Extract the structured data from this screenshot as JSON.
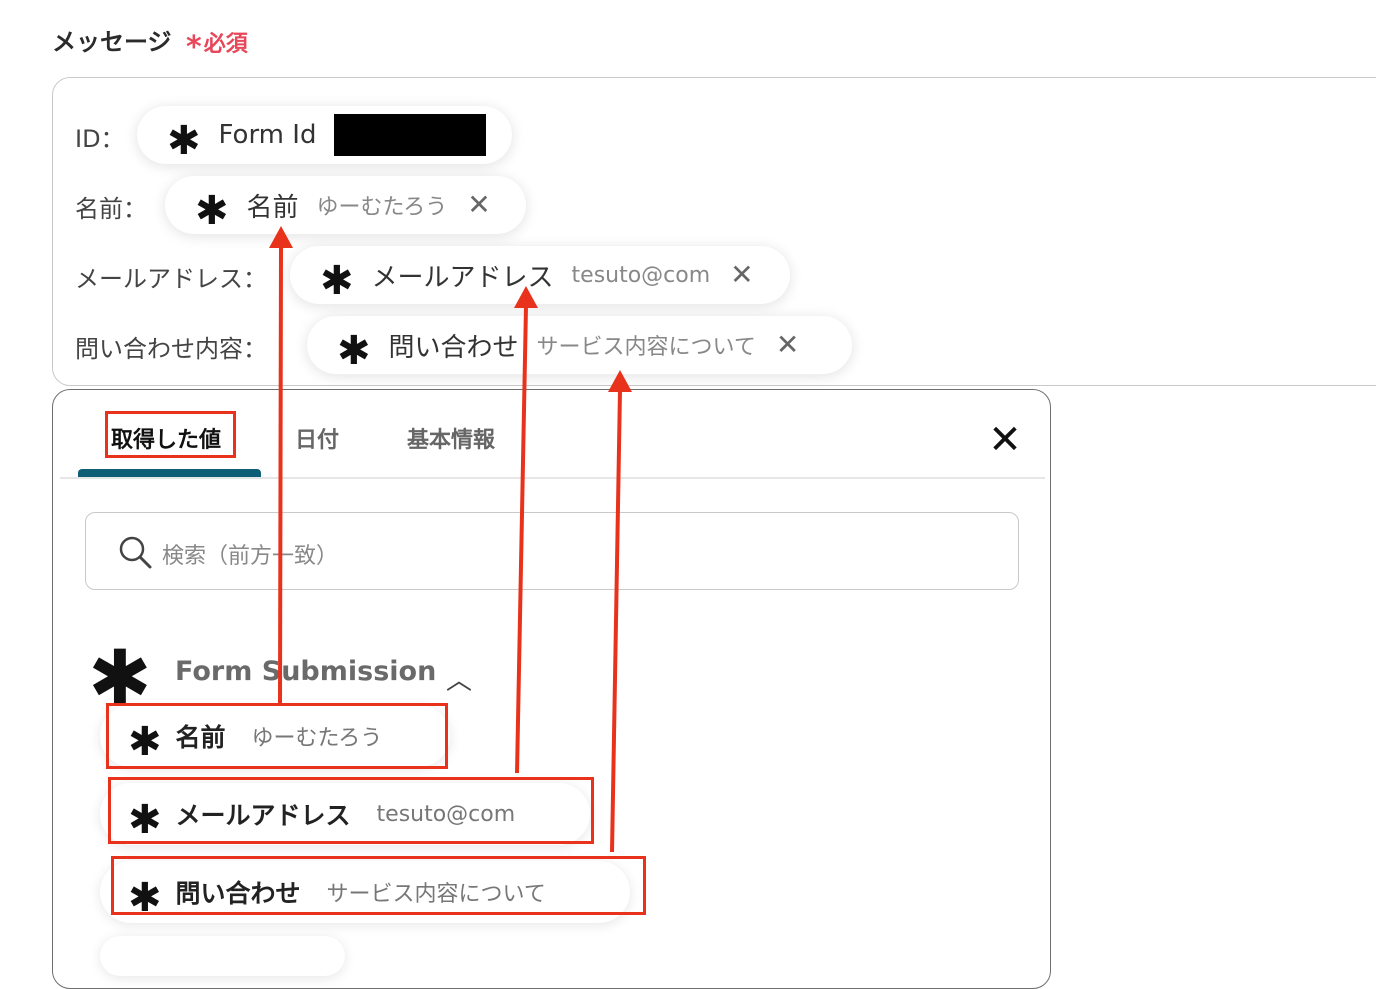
{
  "message_field": {
    "label": "メッセージ",
    "required_mark": "*",
    "required_text": "必須"
  },
  "rows": [
    {
      "label": "ID：",
      "chip_name": "Form Id",
      "chip_value": "",
      "has_close": false,
      "redacted": true
    },
    {
      "label": "名前：",
      "chip_name": "名前",
      "chip_value": "ゆーむたろう",
      "has_close": true
    },
    {
      "label": "メールアドレス：",
      "chip_name": "メールアドレス",
      "chip_value": "tesuto@com",
      "has_close": true
    },
    {
      "label": "問い合わせ内容：",
      "chip_name": "問い合わせ",
      "chip_value": "サービス内容について",
      "has_close": true
    }
  ],
  "chip_icon": "asterisk-icon",
  "close_icon": "close-x-icon",
  "panel": {
    "tabs": [
      {
        "label": "取得した値",
        "active": true
      },
      {
        "label": "日付",
        "active": false
      },
      {
        "label": "基本情報",
        "active": false
      }
    ],
    "close_glyph": "✕",
    "search_placeholder": "検索（前方一致）",
    "group": {
      "title": "Form Submission",
      "expanded": true,
      "items": [
        {
          "name": "名前",
          "value": "ゆーむたろう"
        },
        {
          "name": "メールアドレス",
          "value": "tesuto@com"
        },
        {
          "name": "問い合わせ",
          "value": "サービス内容について"
        }
      ]
    }
  },
  "colors": {
    "required": "#e8475a",
    "tab_underline": "#0e5f76",
    "annotation_red": "#e8321c"
  }
}
